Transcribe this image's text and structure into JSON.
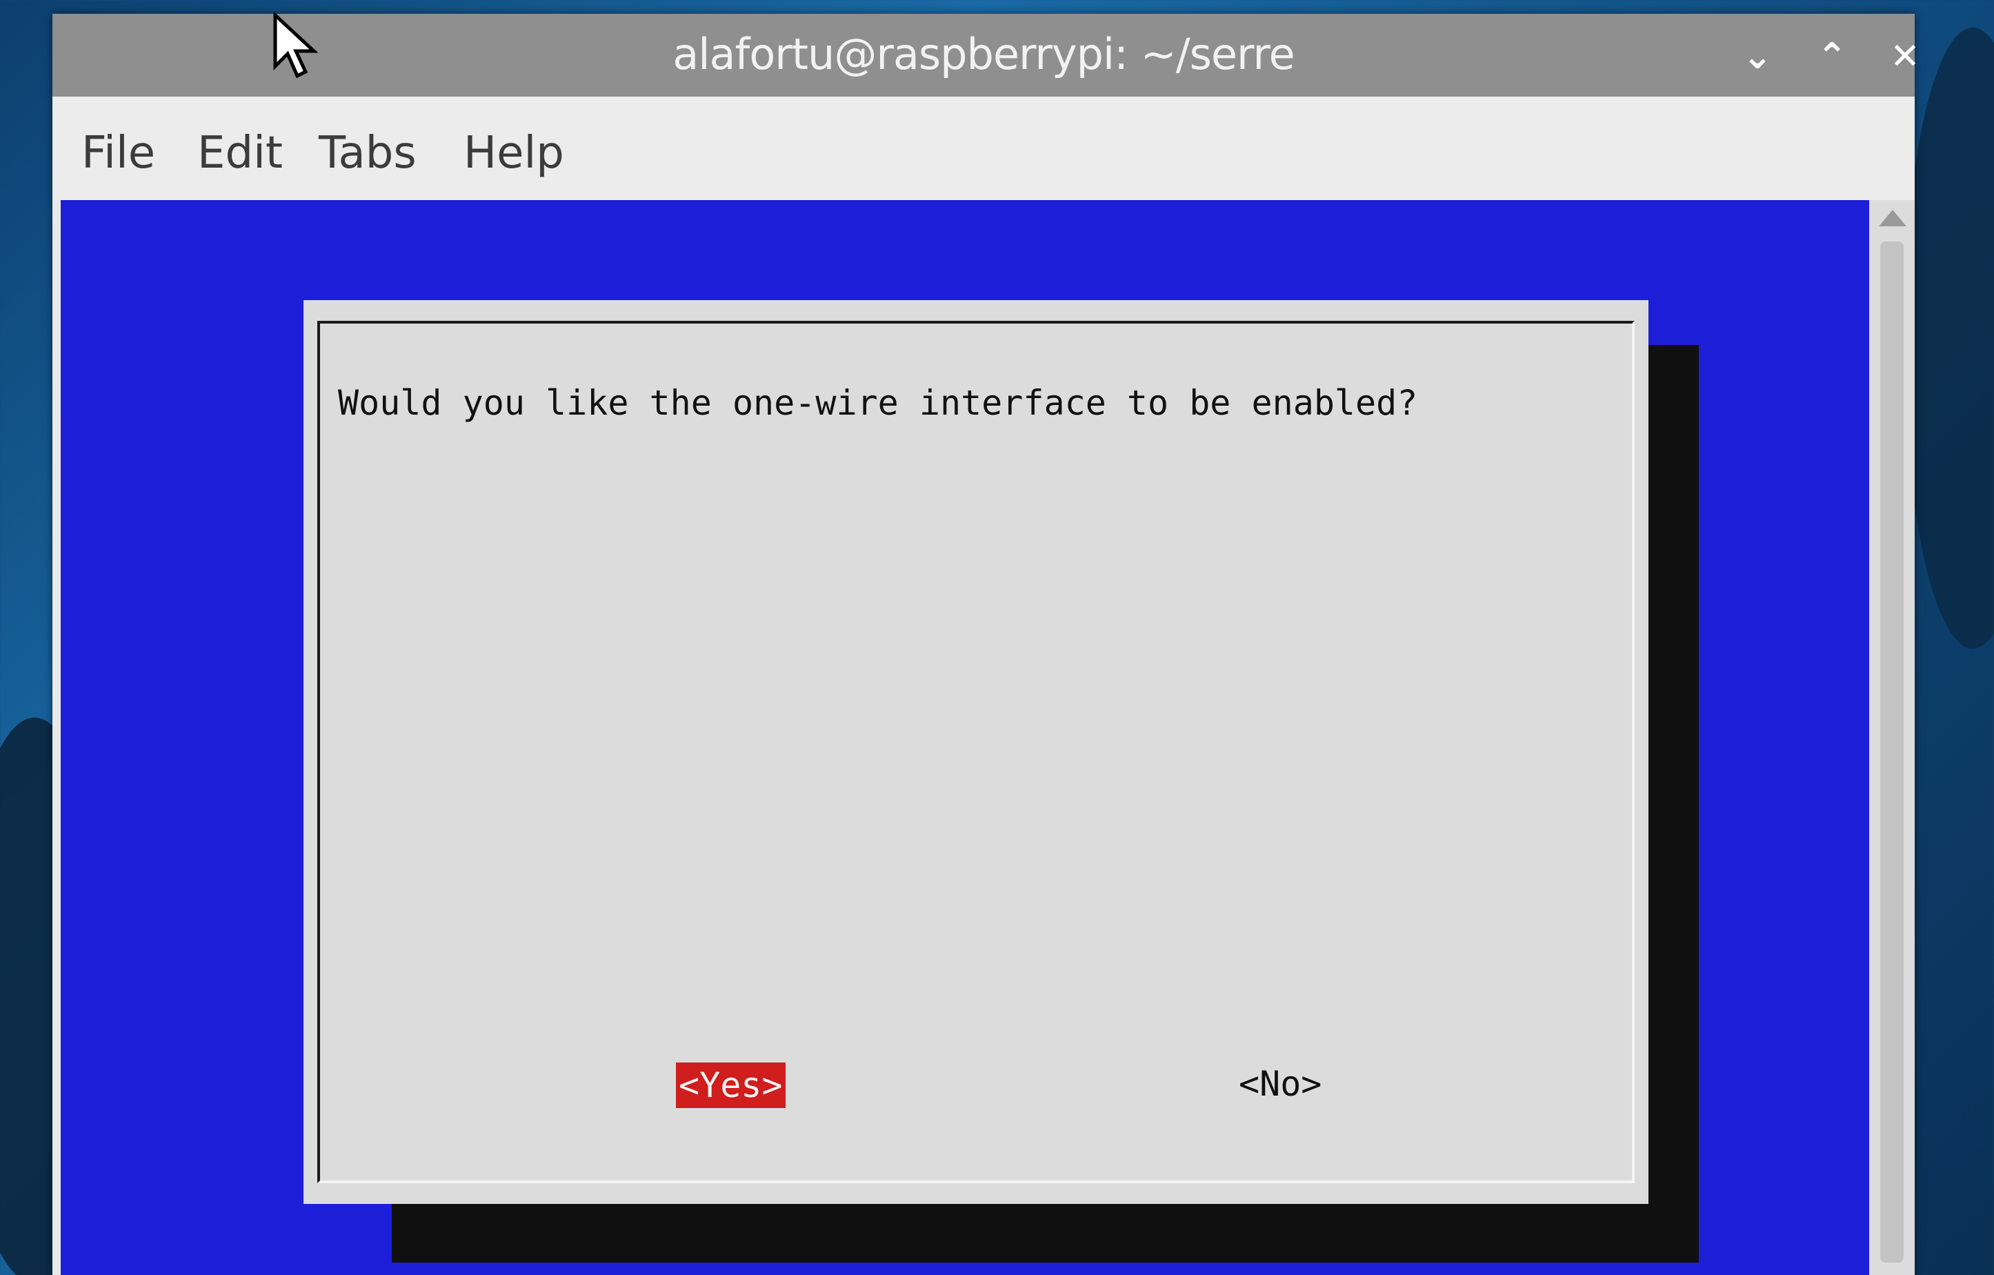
{
  "window": {
    "title": "alafortu@raspberrypi: ~/serre",
    "buttons": {
      "minimize": "⌄",
      "maximize": "⌃",
      "close": "✕"
    }
  },
  "menubar": {
    "items": [
      "File",
      "Edit",
      "Tabs",
      "Help"
    ]
  },
  "dialog": {
    "question": "Would you like the one-wire interface to be enabled?",
    "yes_label": "<Yes>",
    "no_label": "<No>"
  },
  "colors": {
    "terminal_background": "#1d1ed8",
    "dialog_background": "#dcdcdc",
    "selected_button": "#d01d1d",
    "titlebar": "#8f8f8f"
  },
  "icons": [
    "mouse-pointer-icon",
    "minimize-icon",
    "maximize-icon",
    "close-icon",
    "scroll-up-icon"
  ]
}
